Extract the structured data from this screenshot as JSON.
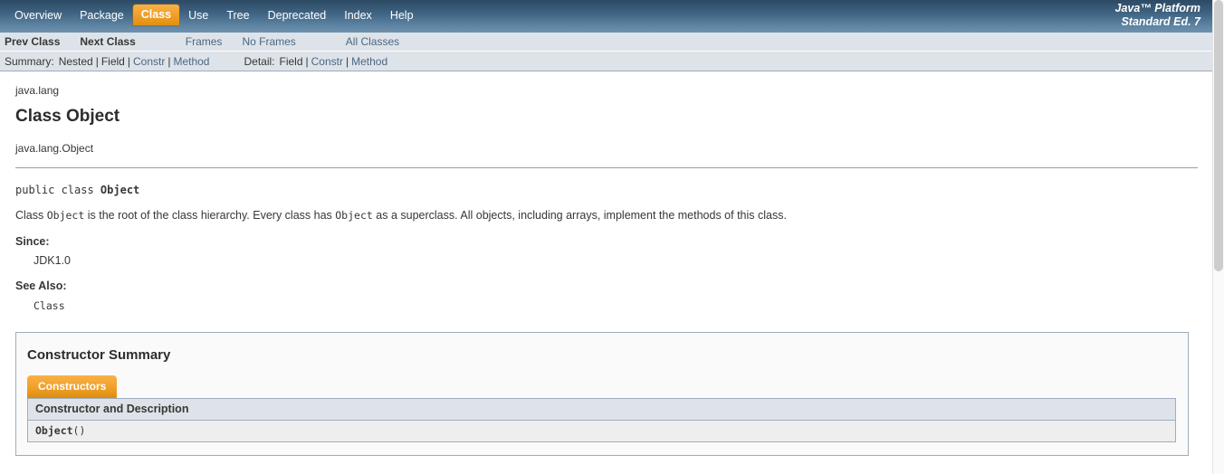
{
  "topnav": {
    "items": [
      {
        "label": "Overview",
        "active": false
      },
      {
        "label": "Package",
        "active": false
      },
      {
        "label": "Class",
        "active": true
      },
      {
        "label": "Use",
        "active": false
      },
      {
        "label": "Tree",
        "active": false
      },
      {
        "label": "Deprecated",
        "active": false
      },
      {
        "label": "Index",
        "active": false
      },
      {
        "label": "Help",
        "active": false
      }
    ],
    "product_line1": "Java™ Platform",
    "product_line2": "Standard Ed. 7"
  },
  "subnav": {
    "prev_class": "Prev Class",
    "next_class": "Next Class",
    "frames": "Frames",
    "no_frames": "No Frames",
    "all_classes": "All Classes",
    "summary_label": "Summary:",
    "summary_nested": "Nested",
    "summary_field": "Field",
    "summary_constr": "Constr",
    "summary_method": "Method",
    "detail_label": "Detail:",
    "detail_field": "Field",
    "detail_constr": "Constr",
    "detail_method": "Method",
    "sep": "|"
  },
  "main": {
    "package_name": "java.lang",
    "class_title": "Class Object",
    "fqcn": "java.lang.Object",
    "declaration_prefix": "public class ",
    "declaration_name": "Object",
    "description": {
      "part1": "Class ",
      "code1": "Object",
      "part2": " is the root of the class hierarchy. Every class has ",
      "code2": "Object",
      "part3": " as a superclass. All objects, including arrays, implement the methods of this class."
    },
    "since_label": "Since:",
    "since_value": "JDK1.0",
    "see_also_label": "See Also:",
    "see_also_value": "Class"
  },
  "constructor_summary": {
    "title": "Constructor Summary",
    "tab_label": "Constructors",
    "column_header": "Constructor and Description",
    "rows": [
      {
        "name": "Object",
        "signature": "()"
      }
    ]
  },
  "colors": {
    "nav_top": "#2c4a63",
    "nav_bottom": "#6f92af",
    "accent_orange": "#f0a02a",
    "link_blue": "#4a6782",
    "subnav_bg": "#dee3e9",
    "table_row_bg": "#eeeeef",
    "text": "#353833"
  }
}
